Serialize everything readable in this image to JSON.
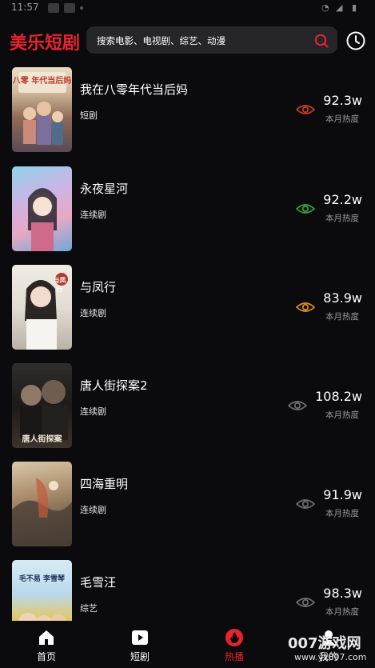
{
  "status_bar": {
    "time": "11:57"
  },
  "header": {
    "brand": "美乐短剧",
    "search_placeholder": "搜索电影、电视剧、综艺、动漫",
    "search_icon": "search-icon",
    "history_icon": "clock-icon"
  },
  "list": {
    "views_label": "本月热度",
    "items": [
      {
        "title": "我在八零年代当后妈",
        "tag": "短剧",
        "views": "92.3w",
        "eye_color": "#c0392b",
        "poster_text": "八零 年代当后妈"
      },
      {
        "title": "永夜星河",
        "tag": "连续剧",
        "views": "92.2w",
        "eye_color": "#2e9e3e",
        "poster_text": ""
      },
      {
        "title": "与凤行",
        "tag": "连续剧",
        "views": "83.9w",
        "eye_color": "#d88a1e",
        "poster_text": "与凤行"
      },
      {
        "title": "唐人街探案2",
        "tag": "连续剧",
        "views": "108.2w",
        "eye_color": "#6a6a6a",
        "poster_text": "唐人街探案"
      },
      {
        "title": "四海重明",
        "tag": "连续剧",
        "views": "91.9w",
        "eye_color": "#6a6a6a",
        "poster_text": ""
      },
      {
        "title": "毛雪汪",
        "tag": "综艺",
        "views": "98.3w",
        "eye_color": "#6a6a6a",
        "poster_text": "毛不易 李雪琴"
      }
    ]
  },
  "bottom_nav": {
    "items": [
      {
        "label": "首页",
        "icon": "home-icon",
        "active": false
      },
      {
        "label": "短剧",
        "icon": "play-icon",
        "active": false
      },
      {
        "label": "热播",
        "icon": "fire-icon",
        "active": true
      },
      {
        "label": "我的",
        "icon": "user-icon",
        "active": false
      }
    ]
  },
  "watermark": {
    "main": "007游戏网",
    "sub": "www.yx007.com"
  },
  "colors": {
    "accent": "#e8232e",
    "background": "#0b0b0d",
    "search_bg": "#26262a"
  }
}
